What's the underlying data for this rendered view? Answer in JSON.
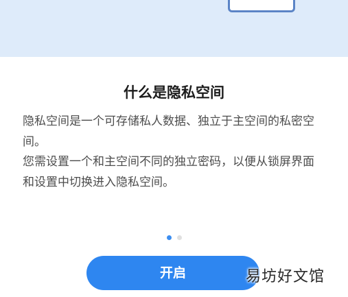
{
  "intro": {
    "title": "什么是隐私空间",
    "paragraph_1": "隐私空间是一个可存储私人数据、独立于主空间的私密空间。",
    "paragraph_2": "您需设置一个和主空间不同的独立密码，以便从锁屏界面和设置中切换进入隐私空间。"
  },
  "pager": {
    "total_pages": 2,
    "current_page": 1
  },
  "start_button": {
    "label": "开启"
  },
  "watermark": {
    "text": "易坊好文馆"
  },
  "colors": {
    "accent": "#2e86f0",
    "hero_background": "#deebfa",
    "title_text": "#1c1c1c",
    "body_text": "#4d4d4d"
  }
}
